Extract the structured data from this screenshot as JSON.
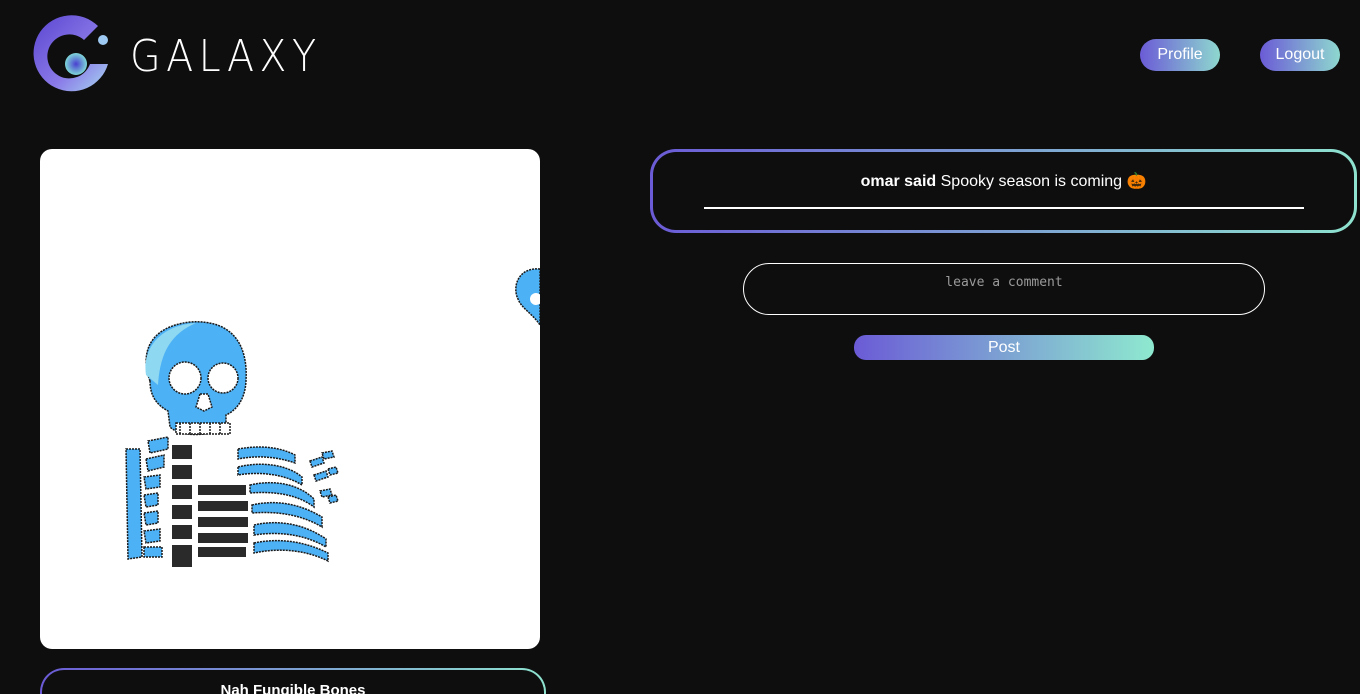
{
  "header": {
    "brand": "GALAXY",
    "profile_label": "Profile",
    "logout_label": "Logout"
  },
  "post": {
    "title": "Nah Fungible Bones"
  },
  "comments": [
    {
      "author": "omar said",
      "text": "Spooky season is coming 🎃"
    }
  ],
  "comment_form": {
    "placeholder": "leave a comment",
    "post_label": "Post"
  },
  "colors": {
    "background": "#0e0e0e",
    "gradient_start": "#6b5bd6",
    "gradient_end": "#8ee3cf",
    "bone_blue": "#4db1f5"
  }
}
